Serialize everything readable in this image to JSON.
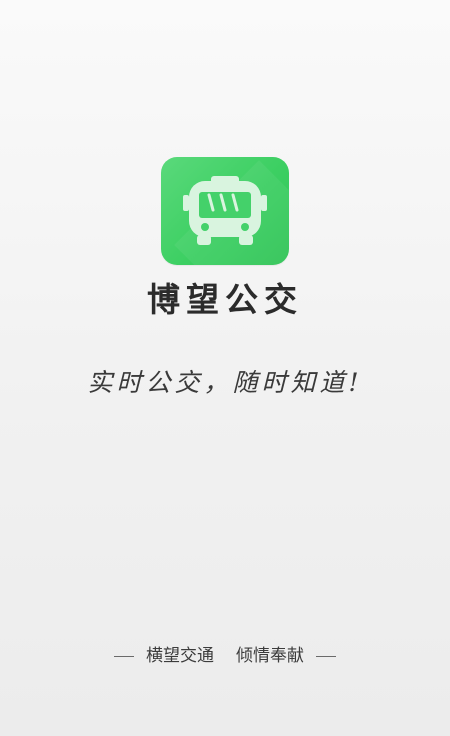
{
  "app": {
    "name": "博望公交",
    "slogan": "实时公交，随时知道!"
  },
  "footer": {
    "part1": "横望交通",
    "part2": "倾情奉献"
  },
  "icon": {
    "name": "bus-icon",
    "bg_color": "#3ccf62",
    "glyph_color": "#d9f4df"
  }
}
